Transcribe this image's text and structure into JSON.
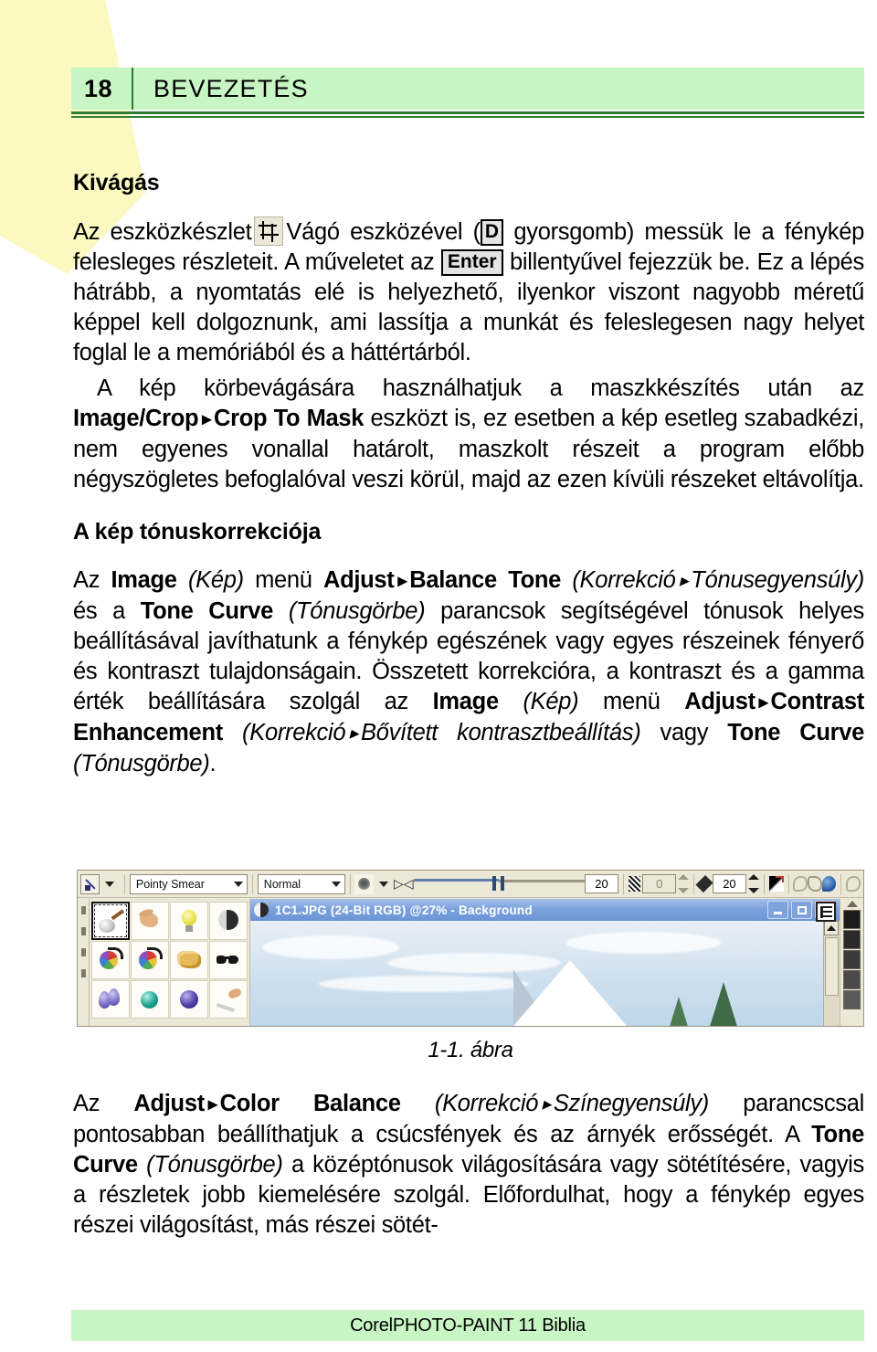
{
  "header": {
    "page_number": "18",
    "title": "BEVEZETÉS",
    "band_color": "#c8f5c4",
    "rule_color": "#2f7d32"
  },
  "sections": {
    "crop": {
      "heading": "Kivágás",
      "para1": {
        "before_icon": "Az eszközkészlet",
        "icon_name": "crop-tool-icon",
        "after_icon": "Vágó eszközével (",
        "key_d": "D",
        "mid": " gyorsgomb) messük le a fénykép felesleges részleteit. A műveletet az ",
        "key_enter": "Enter",
        "tail": " billentyűvel fejezzük be. Ez a lépés hátrább, a nyomtatás elé is helyezhető, ilyenkor viszont nagyobb méretű képpel kell dolgoznunk, ami lassítja a munkát és feleslegesen nagy helyet foglal le a memóriából és a háttértárból."
      },
      "para2": {
        "lead": "A kép körbevágására használhatjuk a maszkkészítés után az ",
        "menu_path_1": "Image/Crop",
        "arrow": "▸",
        "menu_path_2": "Crop To Mask",
        "tail": " eszközt is, ez esetben a kép esetleg szabadkézi, nem egyenes vonallal határolt, maszkolt részeit a program előbb négyszögletes befoglalóval veszi körül, majd az ezen kívüli részeket eltávolítja."
      }
    },
    "tone": {
      "heading": "A kép tónuskorrekciója",
      "para": {
        "p1": "Az ",
        "b1": "Image",
        "i1": "(Kép)",
        "p2": " menü ",
        "b2": "Adjust",
        "arrow": "▸",
        "b3": "Balance Tone",
        "i2": "(Korrekció",
        "i3": "Tónusegyensúly)",
        "p3": " és a ",
        "b4": "Tone Curve",
        "i4": "(Tónusgörbe)",
        "p4": " parancsok segítségével tónusok helyes beállításával javíthatunk a fénykép egészének vagy egyes részeinek fényerő és kontraszt tulajdonságain. Összetett korrekcióra, a kontraszt és a gamma érték beállítására szolgál az ",
        "b5": "Image",
        "i5": "(Kép)",
        "p5": " menü ",
        "b6": "Adjust",
        "b7": "Contrast Enhancement",
        "i6": "(Korrekció",
        "i7": "Bővített kontrasztbeállítás)",
        "p6": " vagy ",
        "b8": "Tone Curve",
        "i8": "(Tónusgörbe)",
        "p7": "."
      }
    },
    "closing": {
      "p1": "Az ",
      "b1": "Adjust",
      "arrow": "▸",
      "b2": "Color Balance",
      "i1": "(Korrekció",
      "i2": "Színegyensúly)",
      "p2": " parancscsal pontosabban beállíthatjuk a csúcsfények és az árnyék erősségét. A ",
      "b3": "Tone Curve",
      "i3": "(Tónusgörbe)",
      "p3": " a középtónusok világosítására vagy sötétítésére, vagyis a részletek jobb kiemelésére szolgál. Előfordulhat, hogy a fénykép egyes részei világosítást, más részei sötét-"
    }
  },
  "figure": {
    "caption": "1-1. ábra",
    "property_bar": {
      "tool_icon_name": "brush-tool-icon",
      "brush_type": "Pointy Smear",
      "merge_mode": "Normal",
      "nib_icon_name": "nib-shape-icon",
      "size_link_icon_name": "link-size-icon",
      "transparency_value": "20",
      "feather_value": "0",
      "soft_edge_value": "20",
      "gradient_icon_name": "gradient-icon",
      "ghost_icon_1_name": "stroke-ghost-icon",
      "ghost_icon_2_name": "orbit-ghost-icon",
      "blue_blob_icon_name": "blend-blob-icon",
      "ghost_icon_3_name": "spiral-ghost-icon"
    },
    "tool_palette": {
      "name": "effect-tool-palette",
      "items": [
        {
          "name": "smear-tool",
          "art": "pi-smear",
          "selected": true
        },
        {
          "name": "smudge-hand-tool",
          "art": "pi-hand",
          "selected": false
        },
        {
          "name": "brightness-bulb-tool",
          "art": "pi-bulb",
          "selected": false
        },
        {
          "name": "contrast-sphere-tool",
          "art": "pi-sphere",
          "selected": false
        },
        {
          "name": "hue-wheel-tool",
          "art": "pi-colorwheel",
          "selected": false
        },
        {
          "name": "hue-replacer-tool",
          "art": "pi-colorwheel",
          "selected": false
        },
        {
          "name": "sponge-tool",
          "art": "pi-sponge",
          "selected": false
        },
        {
          "name": "tint-glasses-tool",
          "art": "pi-glasses",
          "selected": false
        },
        {
          "name": "blur-drop-tool",
          "art": "pi-drop",
          "selected": false
        },
        {
          "name": "sharpen-ball-tool",
          "art": "pi-teal",
          "selected": false
        },
        {
          "name": "undither-ball-tool",
          "art": "pi-purple",
          "selected": false
        },
        {
          "name": "smudge-knife-tool",
          "art": "pi-knife",
          "selected": false
        }
      ]
    },
    "document_window": {
      "title": "1C1.JPG (24-Bit RGB) @27% - Background",
      "minimize_label": "—",
      "maximize_label": "□",
      "close_label": "×",
      "titlebar_color": "#7ca2dd",
      "close_color": "#c96b6b"
    },
    "canvas": {
      "description": "sky-with-mountain-and-pines",
      "sky_top": "#e8eff6",
      "sky_bottom": "#bed7ea"
    },
    "color_strip": {
      "name": "color-palette-strip",
      "swatches": [
        "#1b1b1b",
        "#2a2a2a",
        "#3a3a3a",
        "#4a4a4a",
        "#5a5a5a"
      ]
    }
  },
  "footer": {
    "text": "CorelPHOTO-PAINT 11 Biblia",
    "band_color": "#c8f5c4"
  }
}
